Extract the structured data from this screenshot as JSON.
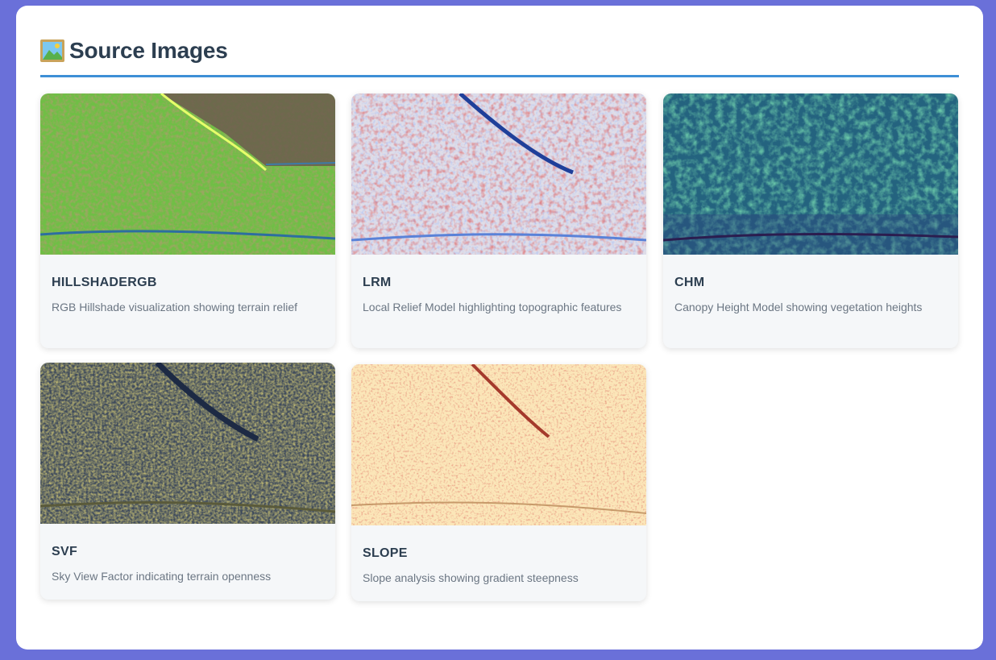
{
  "header": {
    "icon": "framed-picture-icon",
    "title": "Source Images"
  },
  "cards": [
    {
      "title": "HILLSHADERGB",
      "description": "RGB Hillshade visualization showing terrain relief",
      "image": "hillshade-rgb-image"
    },
    {
      "title": "LRM",
      "description": "Local Relief Model highlighting topographic features",
      "image": "local-relief-model-image"
    },
    {
      "title": "CHM",
      "description": "Canopy Height Model showing vegetation heights",
      "image": "canopy-height-model-image"
    },
    {
      "title": "SVF",
      "description": "Sky View Factor indicating terrain openness",
      "image": "sky-view-factor-image"
    },
    {
      "title": "SLOPE",
      "description": "Slope analysis showing gradient steepness",
      "image": "slope-image"
    }
  ],
  "colors": {
    "page_background": "#6a70d9",
    "panel": "#ffffff",
    "accent": "#3d8fd6",
    "heading": "#2c3e50",
    "muted_text": "#6b7683"
  }
}
